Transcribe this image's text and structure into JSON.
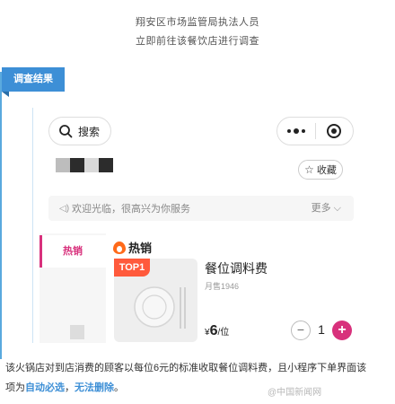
{
  "header": {
    "line1": "翔安区市场监管局执法人员",
    "line2": "立即前往该餐饮店进行调查"
  },
  "section_tag": "调查结果",
  "app": {
    "search_label": "搜索",
    "capsule": {
      "menu_icon": "more-dots-icon",
      "close_icon": "target-icon"
    },
    "favorite_label": "收藏",
    "notice": {
      "text": "欢迎光临，很高兴为你服务",
      "more_label": "更多"
    },
    "sidebar": {
      "active_label": "热销"
    },
    "section_header": "热销",
    "product": {
      "badge": "TOP1",
      "name": "餐位调料费",
      "sales": "月售1946",
      "currency": "¥",
      "price": "6",
      "unit": "/位",
      "quantity": "1"
    },
    "colors": {
      "accent": "#d8317c",
      "badge": "#ff5a3c",
      "tag": "#3d8fd6"
    }
  },
  "caption": {
    "line1": "该火锅店对到店消费的顾客以每位6元的标准收取餐位调料费，且小程序下单界面该",
    "line2_prefix": "项为",
    "highlight1": "自动必选",
    "sep": "，",
    "highlight2": "无法删除",
    "end": "。"
  },
  "watermark": "@中国新闻网"
}
